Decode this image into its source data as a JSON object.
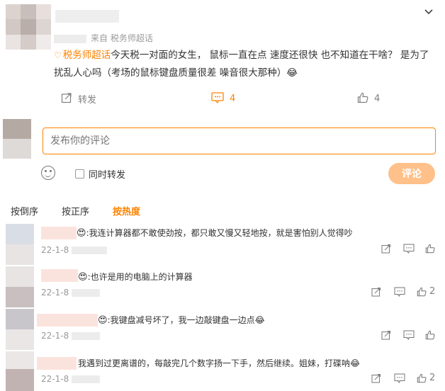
{
  "post": {
    "meta_source": "来自 税务师超话",
    "topic_label": "税务师超话",
    "text": "今天税一对面的女生，  鼠标一直在点 速度还很快  也不知道在干啥？  是为了扰乱人心吗（考场的鼠标键盘质量很差  噪音很大那种）😂",
    "share_label": "转发",
    "comment_count": "4",
    "like_count": "4"
  },
  "composer": {
    "placeholder": "发布你的评论",
    "repost_label": "同时转发",
    "submit_label": "评论"
  },
  "sort_tabs": [
    "按倒序",
    "按正序",
    "按热度"
  ],
  "comments": [
    {
      "text": "我连计算器都不敢使劲按，都只敢又慢又轻地按，就是害怕别人觉得吵",
      "date": "22-1-8",
      "likes": ""
    },
    {
      "text": "也许是用的电脑上的计算器",
      "date": "22-1-8",
      "likes": "2"
    },
    {
      "text": "我键盘减号坏了，我一边敲键盘一边点😂",
      "date": "22-1-8",
      "likes": ""
    },
    {
      "text": "我遇到过更离谱的，每敲完几个数字扬一下手，然后继续。姐妹，打碟呐😂",
      "date": "22-1-8",
      "likes": "2"
    }
  ],
  "colors": {
    "accent": "#ff8200",
    "submit_disabled": "#ffc089"
  }
}
